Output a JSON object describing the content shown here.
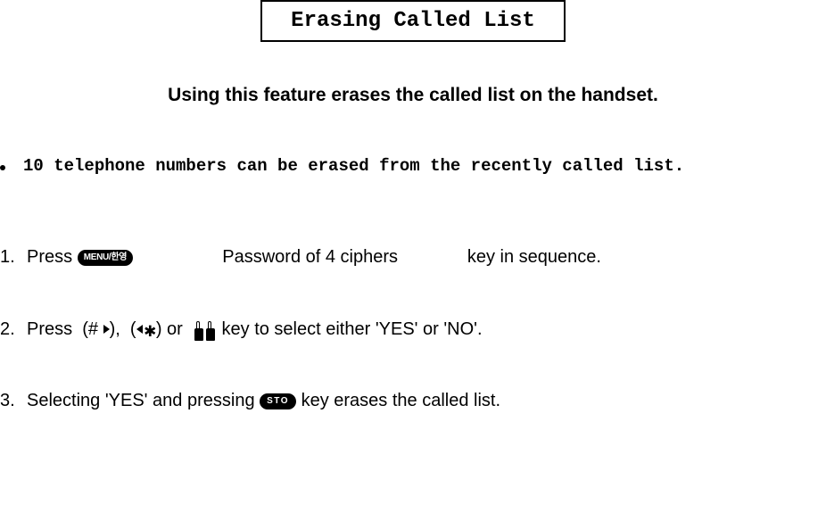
{
  "title": "Erasing Called List",
  "subheading": "Using this feature erases the called list on the handset.",
  "bullet": "10 telephone numbers can be erased from the recently called list.",
  "keys": {
    "menu_label": "MENU/한영",
    "sto_label": "STO"
  },
  "step1": {
    "num": "1.",
    "press": "Press ",
    "password": "Password of 4 ciphers",
    "seq": " key in sequence."
  },
  "step2": {
    "num": "2.",
    "press": "Press  (# ",
    "mid1": "),  (",
    "ast": "✱",
    "mid2": ") or  ",
    "tail": " key to select either 'YES' or 'NO'."
  },
  "step3": {
    "num": "3.",
    "lead": "Selecting 'YES' and pressing ",
    "tail": " key erases the called list."
  }
}
